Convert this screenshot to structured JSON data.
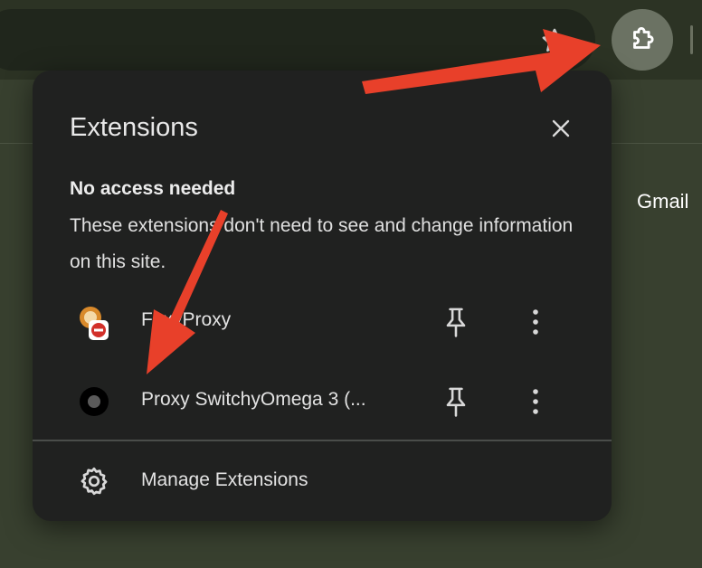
{
  "toolbar": {
    "extensions_button_icon": "puzzle-piece-icon",
    "bookmark_icon": "star-icon"
  },
  "page": {
    "gmail_link": "Gmail"
  },
  "panel": {
    "title": "Extensions",
    "close_icon": "close-icon",
    "section_heading": "No access needed",
    "section_description": "These extensions don't need to see and change information on this site.",
    "extensions": [
      {
        "name": "FoxyProxy",
        "icon": "foxyproxy-icon",
        "pin_icon": "pin-icon",
        "menu_icon": "more-vert-icon"
      },
      {
        "name": "Proxy SwitchyOmega 3 (...",
        "icon": "switchyomega-icon",
        "pin_icon": "pin-icon",
        "menu_icon": "more-vert-icon"
      }
    ],
    "manage_label": "Manage Extensions",
    "manage_icon": "gear-icon"
  },
  "colors": {
    "panel_bg": "#202120",
    "arrow": "#e8402a",
    "background": "#38402f"
  }
}
